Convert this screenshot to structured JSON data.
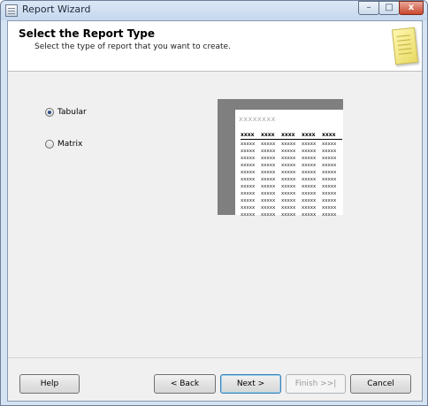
{
  "window": {
    "title": "Report Wizard",
    "controls": {
      "minimize": "–",
      "maximize": "□",
      "close": "x"
    }
  },
  "header": {
    "title": "Select the Report Type",
    "subtitle": "Select the type of report that you want to create.",
    "icon": "notepad-icon"
  },
  "options": [
    {
      "label": "Tabular",
      "checked": true
    },
    {
      "label": "Matrix",
      "checked": false
    }
  ],
  "preview": {
    "title": "xxxxxxxx",
    "columns": [
      "xxxx",
      "xxxx",
      "xxxx",
      "xxxx",
      "xxxx"
    ],
    "cell": "xxxxx",
    "row_count": 11
  },
  "buttons": {
    "help": "Help",
    "back": "< Back",
    "next": "Next >",
    "finish": "Finish >>|",
    "cancel": "Cancel"
  }
}
